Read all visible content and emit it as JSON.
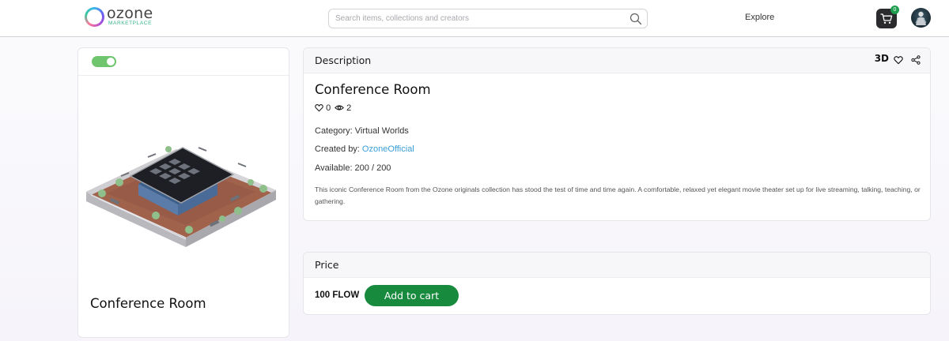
{
  "header": {
    "logo_word": "ozone",
    "logo_sub": "MARKETPLACE",
    "search_placeholder": "Search items, collections and creators",
    "explore_label": "Explore",
    "cart_count": "0"
  },
  "item": {
    "title": "Conference Room"
  },
  "description_panel": {
    "heading": "Description",
    "view_3d_label": "3D",
    "title": "Conference Room",
    "likes": "0",
    "views": "2",
    "category_label": "Category: Virtual Worlds",
    "created_by_prefix": "Created by: ",
    "creator": "OzoneOfficial",
    "available_label": "Available: 200 / 200",
    "text": "This iconic Conference Room from the Ozone originals collection has stood the test of time and time again. A comfortable, relaxed yet elegant movie theater set up for live streaming, talking, teaching, or gathering."
  },
  "price_panel": {
    "heading": "Price",
    "price": "100 FLOW",
    "add_to_cart_label": "Add to cart"
  },
  "colors": {
    "accent_green": "#178a3e",
    "toggle_green": "#6fc56e",
    "link_blue": "#3a9ed6"
  },
  "icons": {
    "search": "search-icon",
    "cart": "cart-icon",
    "heart": "heart-icon",
    "eye": "eye-icon",
    "share": "share-icon"
  }
}
